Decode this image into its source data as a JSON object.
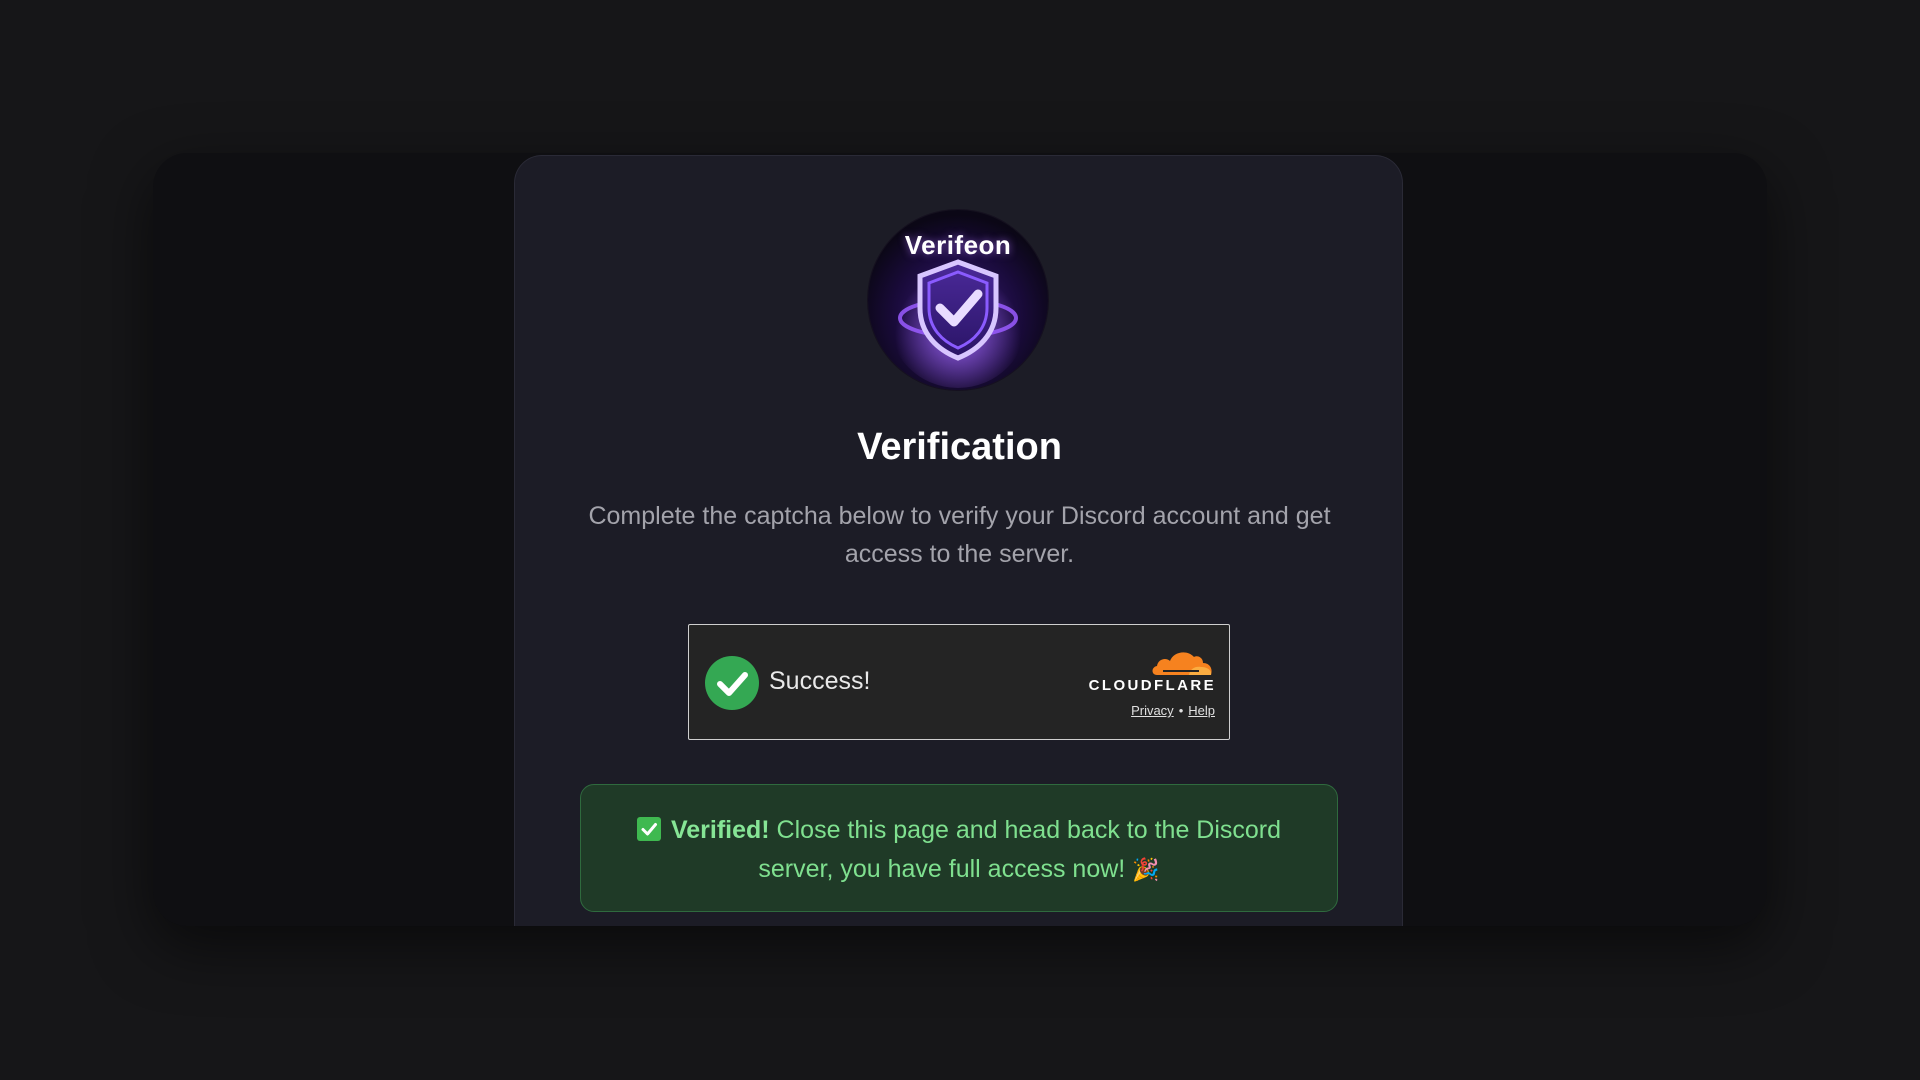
{
  "logo": {
    "wordmark": "Verifeon",
    "icon": "shield-check-icon"
  },
  "heading": {
    "title": "Verification"
  },
  "description": {
    "text": "Complete the captcha below to verify your Discord account and get access to the server."
  },
  "captcha": {
    "status_text": "Success!",
    "status_icon": "check-circle-icon",
    "brand": "CLOUDFLARE",
    "privacy_link": "Privacy",
    "separator": "•",
    "help_link": "Help"
  },
  "alert": {
    "icon": "checkbox-checked-icon",
    "bold_text": "Verified!",
    "message": " Close this page and head back to the Discord server, you have full access now! ",
    "emoji": "🎉"
  },
  "colors": {
    "background": "#161618",
    "card": "#1c1c26",
    "success_green": "#34a853",
    "alert_bg": "#1f3a27",
    "alert_text": "#7fe08f",
    "cloudflare_orange": "#f6821f"
  }
}
